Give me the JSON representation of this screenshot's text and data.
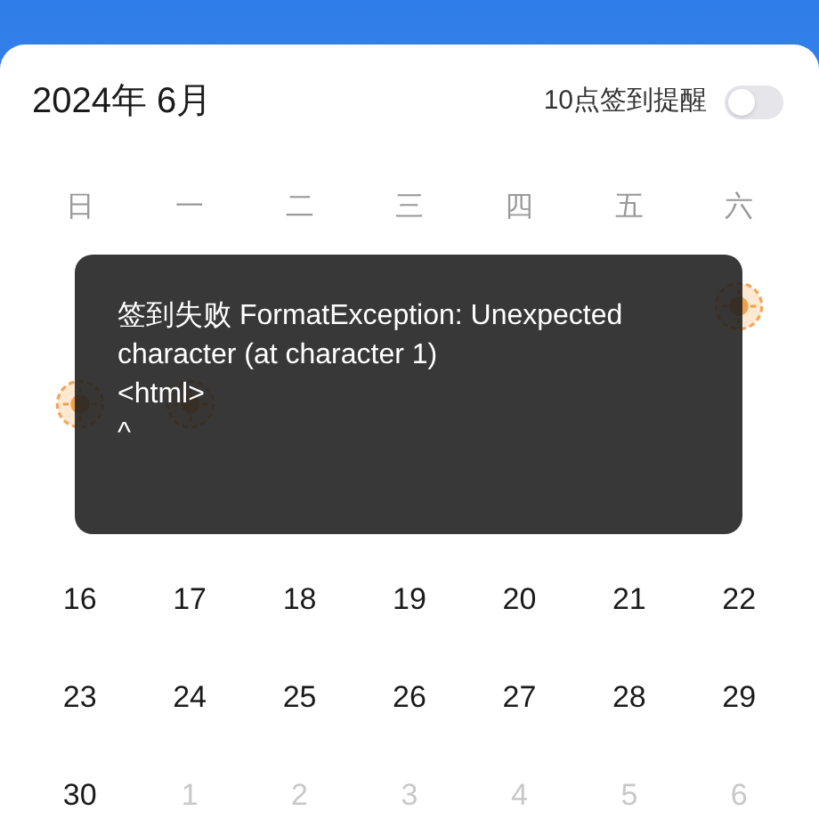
{
  "header": {
    "title": "2024年 6月",
    "reminder_label": "10点签到提醒",
    "reminder_on": false
  },
  "weekdays": [
    "日",
    "一",
    "二",
    "三",
    "四",
    "五",
    "六"
  ],
  "days": [
    {
      "kind": "covered"
    },
    {
      "kind": "covered"
    },
    {
      "kind": "covered"
    },
    {
      "kind": "covered"
    },
    {
      "kind": "covered"
    },
    {
      "kind": "covered"
    },
    {
      "kind": "signed"
    },
    {
      "kind": "signed"
    },
    {
      "kind": "signed"
    },
    {
      "kind": "covered"
    },
    {
      "kind": "covered"
    },
    {
      "kind": "covered"
    },
    {
      "kind": "covered"
    },
    {
      "kind": "covered"
    },
    {
      "kind": "covered"
    },
    {
      "kind": "covered"
    },
    {
      "kind": "covered"
    },
    {
      "kind": "covered"
    },
    {
      "kind": "covered"
    },
    {
      "kind": "covered"
    },
    {
      "kind": "covered"
    },
    {
      "kind": "day",
      "text": "16",
      "muted": false
    },
    {
      "kind": "day",
      "text": "17",
      "muted": false
    },
    {
      "kind": "day",
      "text": "18",
      "muted": false
    },
    {
      "kind": "day",
      "text": "19",
      "muted": false
    },
    {
      "kind": "day",
      "text": "20",
      "muted": false
    },
    {
      "kind": "day",
      "text": "21",
      "muted": false
    },
    {
      "kind": "day",
      "text": "22",
      "muted": false
    },
    {
      "kind": "day",
      "text": "23",
      "muted": false
    },
    {
      "kind": "day",
      "text": "24",
      "muted": false
    },
    {
      "kind": "day",
      "text": "25",
      "muted": false
    },
    {
      "kind": "day",
      "text": "26",
      "muted": false
    },
    {
      "kind": "day",
      "text": "27",
      "muted": false
    },
    {
      "kind": "day",
      "text": "28",
      "muted": false
    },
    {
      "kind": "day",
      "text": "29",
      "muted": false
    },
    {
      "kind": "day",
      "text": "30",
      "muted": false
    },
    {
      "kind": "day",
      "text": "1",
      "muted": true
    },
    {
      "kind": "day",
      "text": "2",
      "muted": true
    },
    {
      "kind": "day",
      "text": "3",
      "muted": true
    },
    {
      "kind": "day",
      "text": "4",
      "muted": true
    },
    {
      "kind": "day",
      "text": "5",
      "muted": true
    },
    {
      "kind": "day",
      "text": "6",
      "muted": true
    }
  ],
  "toast": {
    "lines": [
      "签到失败 FormatException: Unexpected",
      "character (at character 1)",
      "<html>",
      "^"
    ]
  }
}
